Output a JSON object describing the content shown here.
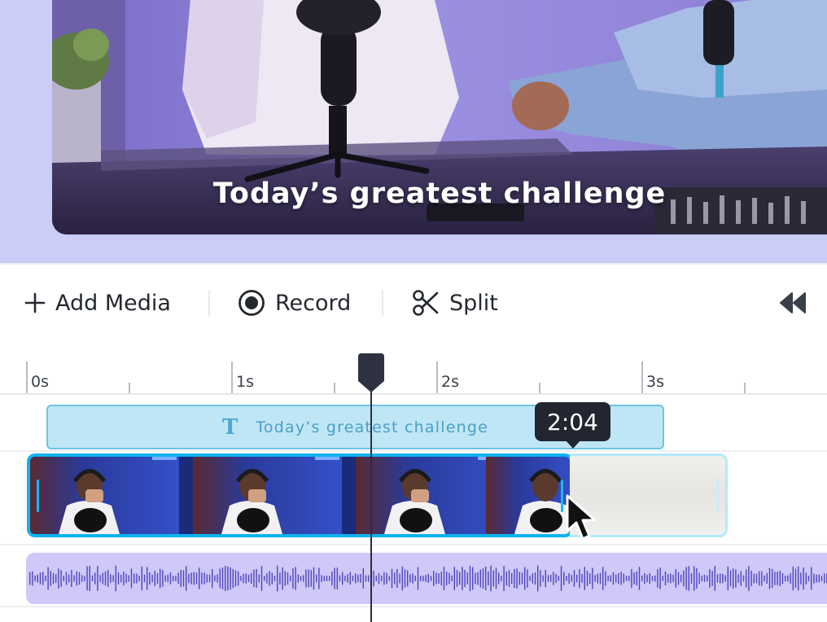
{
  "preview": {
    "caption": "Today’s greatest challenge"
  },
  "toolbar": {
    "add_media_label": "Add Media",
    "record_label": "Record",
    "split_label": "Split"
  },
  "ruler": {
    "labels": [
      "0s",
      "1s",
      "2s",
      "3s"
    ]
  },
  "text_track": {
    "icon_glyph": "T",
    "label": "Today’s greatest challenge"
  },
  "tooltip": {
    "time": "2:04"
  },
  "icons": {
    "add": "plus-icon",
    "record": "record-icon",
    "split": "scissors-icon",
    "rewind": "rewind-icon",
    "text": "text-icon",
    "cursor": "mouse-pointer-icon"
  },
  "colors": {
    "preview_background": "#c9cdf8",
    "clip_border": "#0fb2f0",
    "text_clip_fill": "#bfe6f5",
    "audio_track_fill": "#cfc8f8",
    "waveform": "#4e46b8",
    "playhead": "#2a2e3a",
    "tooltip_bg": "#222630"
  }
}
